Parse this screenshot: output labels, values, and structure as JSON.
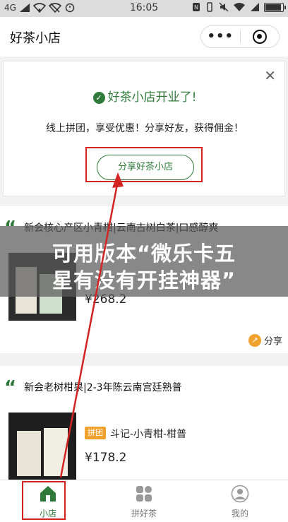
{
  "status_bar": {
    "network": "4G",
    "time": "16:05"
  },
  "header": {
    "title": "好茶小店",
    "more_label": "•••"
  },
  "notice": {
    "title": "好茶小店开业了!",
    "desc": "线上拼团，享受优惠！分享好友，获得佣金！",
    "share_button": "分享好茶小店"
  },
  "products": [
    {
      "title": "新会核心产区小青柑|云南古树白茶|口感醇爽",
      "price": "¥268.2",
      "share_label": "分享"
    },
    {
      "title": "新会老树柑果|2-3年陈云南宫廷熟普",
      "tag": "拼团",
      "name": "斗记-小青柑-柑普",
      "price": "¥178.2"
    }
  ],
  "banner": {
    "line1": "可用版本“微乐卡五",
    "line2": "星有没有开挂神器”"
  },
  "tabbar": {
    "items": [
      {
        "label": "小店",
        "icon": "home-icon",
        "active": true
      },
      {
        "label": "拼好茶",
        "icon": "grid-icon",
        "active": false
      },
      {
        "label": "我的",
        "icon": "user-icon",
        "active": false
      }
    ]
  },
  "colors": {
    "accent": "#2f7a3a",
    "annotation": "#d32424",
    "tag": "#f0a22d"
  }
}
